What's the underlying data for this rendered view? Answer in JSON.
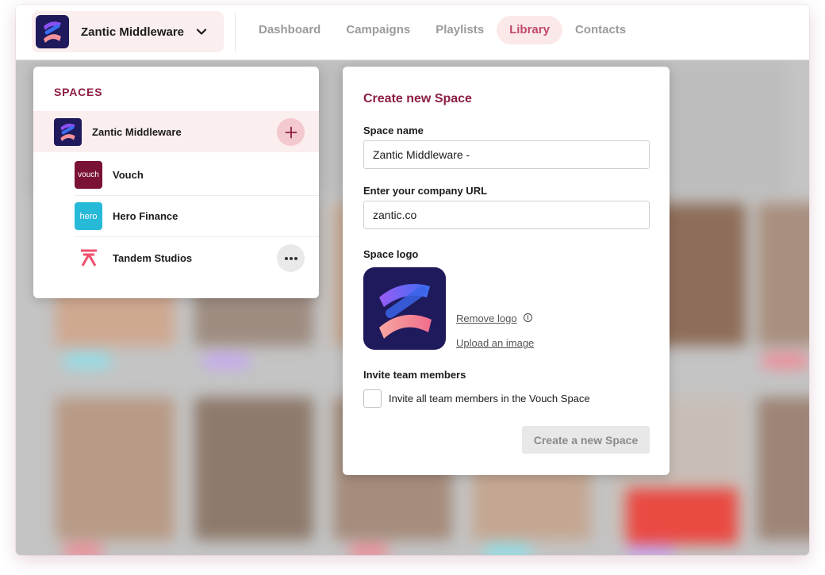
{
  "topbar": {
    "current_space": "Zantic Middleware",
    "nav": [
      {
        "label": "Dashboard",
        "active": false
      },
      {
        "label": "Campaigns",
        "active": false
      },
      {
        "label": "Playlists",
        "active": false
      },
      {
        "label": "Library",
        "active": true
      },
      {
        "label": "Contacts",
        "active": false
      }
    ]
  },
  "spaces_panel": {
    "title": "SPACES",
    "current": {
      "name": "Zantic Middleware",
      "icon": "zantic-logo-icon"
    },
    "children": [
      {
        "name": "Vouch",
        "logo_text": "vouch",
        "color": "#7a1236"
      },
      {
        "name": "Hero Finance",
        "logo_text": "hero",
        "color": "#27b9d8"
      },
      {
        "name": "Tandem Studios",
        "icon": "tandem-logo-icon",
        "color": "#f0506e"
      }
    ]
  },
  "create_space": {
    "title": "Create new Space",
    "space_name_label": "Space name",
    "space_name_value": "Zantic Middleware -",
    "url_label": "Enter your company URL",
    "url_value": "zantic.co",
    "logo_label": "Space logo",
    "remove_logo": "Remove logo",
    "upload_image": "Upload an image",
    "invite_label": "Invite team members",
    "invite_checkbox": "Invite all team members in the Vouch Space",
    "invite_checked": false,
    "submit": "Create a new Space"
  },
  "colors": {
    "brand": "#8c1d44",
    "active_nav_bg": "#fbe9ea",
    "active_nav_text": "#c0476a",
    "space_highlight": "#fbeeee"
  }
}
